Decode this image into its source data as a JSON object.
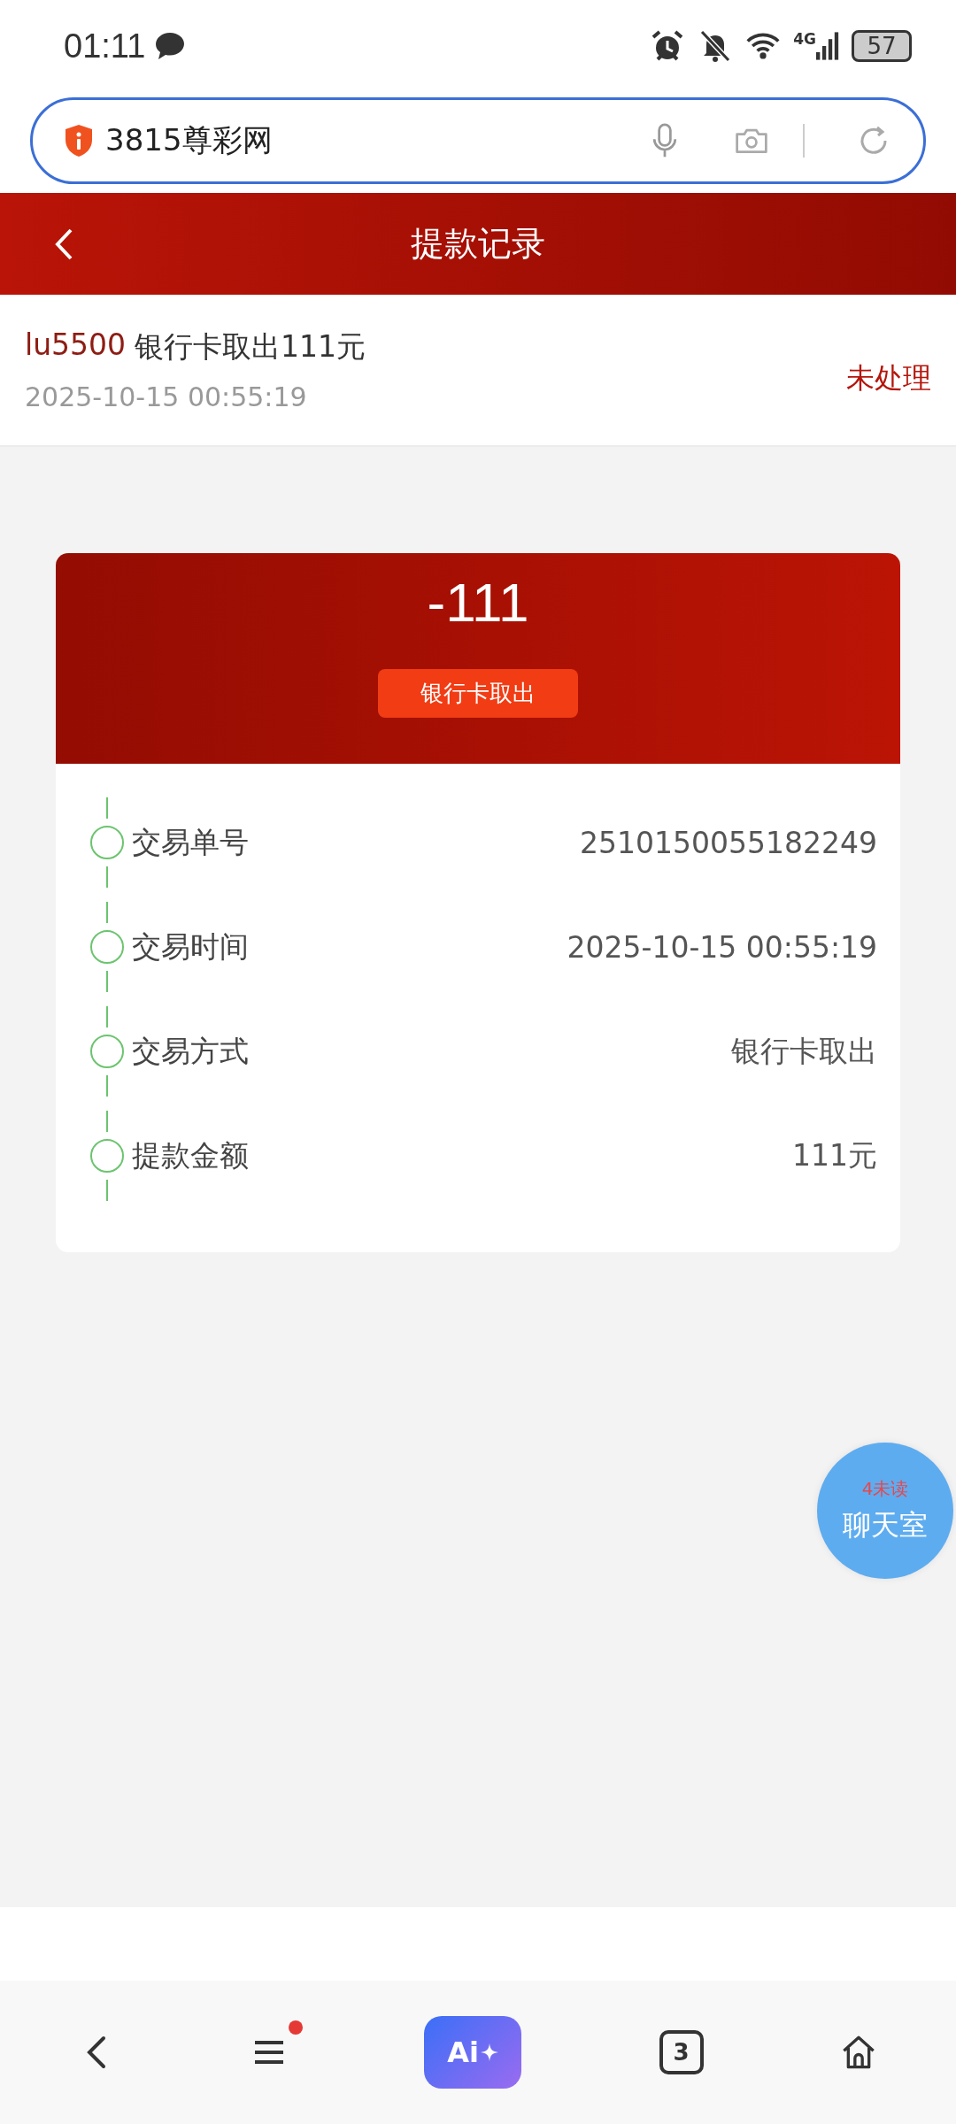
{
  "status_bar": {
    "time": "01:11",
    "network": "4G",
    "battery": "57"
  },
  "address_bar": {
    "value": "3815尊彩网"
  },
  "header": {
    "title": "提款记录"
  },
  "record": {
    "user": "lu5500",
    "description": "银行卡取出111元",
    "time": "2025-10-15 00:55:19",
    "status": "未处理"
  },
  "detail_card": {
    "amount": "-111",
    "method_tag": "银行卡取出",
    "rows": [
      {
        "label": "交易单号",
        "value": "2510150055182249"
      },
      {
        "label": "交易时间",
        "value": "2025-10-15 00:55:19"
      },
      {
        "label": "交易方式",
        "value": "银行卡取出"
      },
      {
        "label": "提款金额",
        "value": "111元"
      }
    ]
  },
  "chat_button": {
    "badge": "4未读",
    "label": "聊天室"
  },
  "bottom_nav": {
    "ai_label": "Ai",
    "tab_count": "3",
    "menu_has_dot": true
  }
}
